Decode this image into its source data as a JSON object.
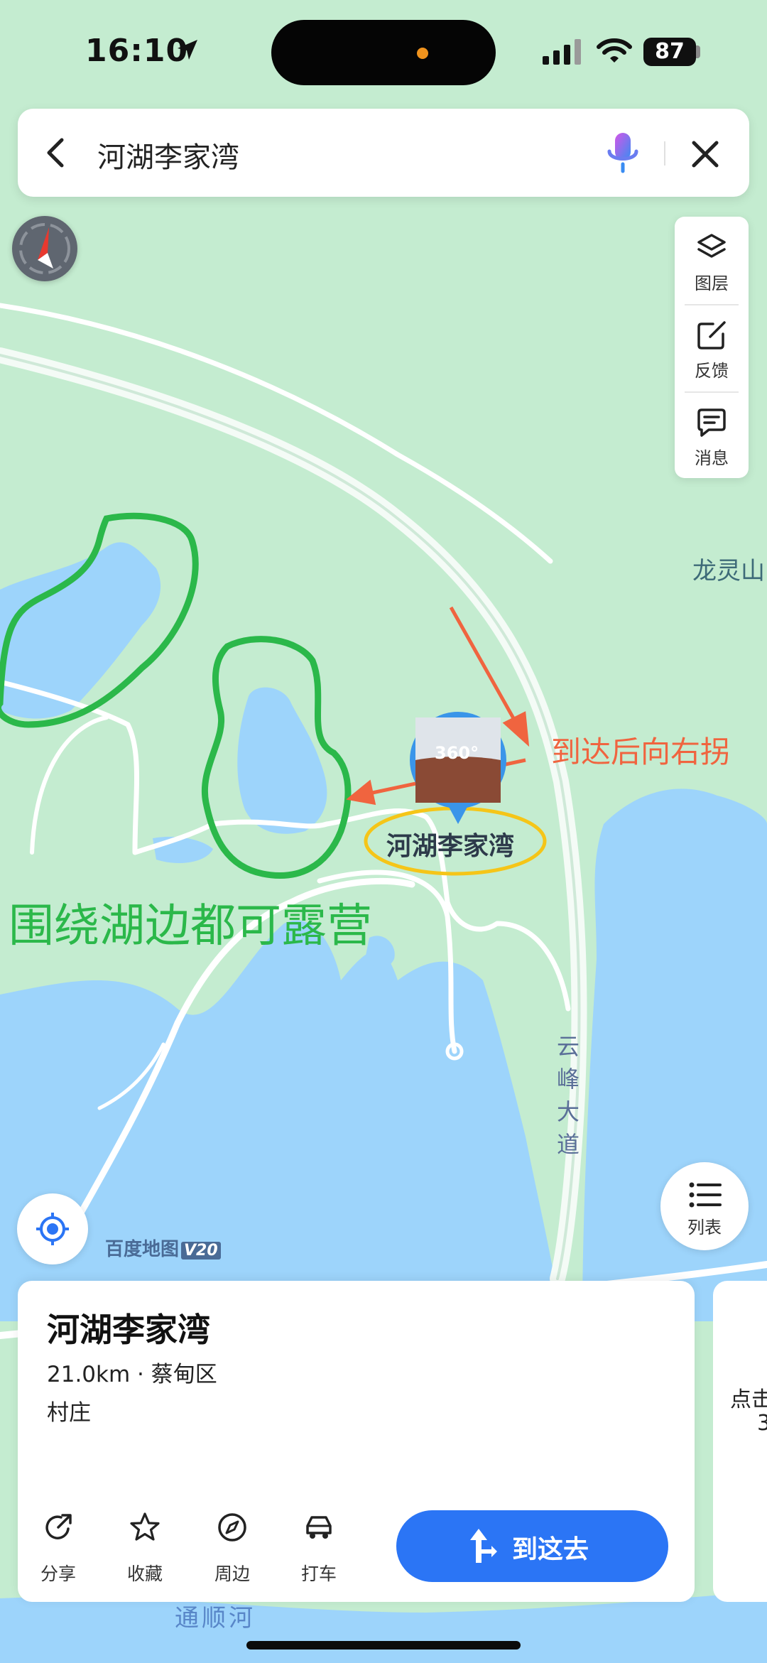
{
  "status": {
    "time": "16:10",
    "battery": "87"
  },
  "search": {
    "query": "河湖李家湾"
  },
  "tools": [
    {
      "label": "图层"
    },
    {
      "label": "反馈"
    },
    {
      "label": "消息"
    }
  ],
  "map": {
    "place_longling": "龙灵山",
    "arrive_note": "到达后向右拐",
    "camp_note": "围绕湖边都可露营",
    "poi_label": "河湖李家湾",
    "poi_badge": "360°",
    "road_name": [
      "云",
      "峰",
      "大",
      "道"
    ],
    "river_name": "通顺河",
    "brand": "百度地图",
    "brand_version": "V20"
  },
  "list_button": {
    "label": "列表"
  },
  "card": {
    "title": "河湖李家湾",
    "subtitle": "21.0km · 蔡甸区",
    "type": "村庄",
    "actions": [
      {
        "label": "分享"
      },
      {
        "label": "收藏"
      },
      {
        "label": "周边"
      },
      {
        "label": "打车"
      }
    ],
    "go_label": "到这去"
  },
  "card2": {
    "line1": "点击",
    "line2": "3"
  },
  "colors": {
    "accent": "#2b75f5",
    "water": "#9dd4fb",
    "land": "#c4ecd0",
    "annotation_red": "#f0643f",
    "annotation_green": "#2bb84a",
    "annotation_yellow": "#f5c518"
  }
}
